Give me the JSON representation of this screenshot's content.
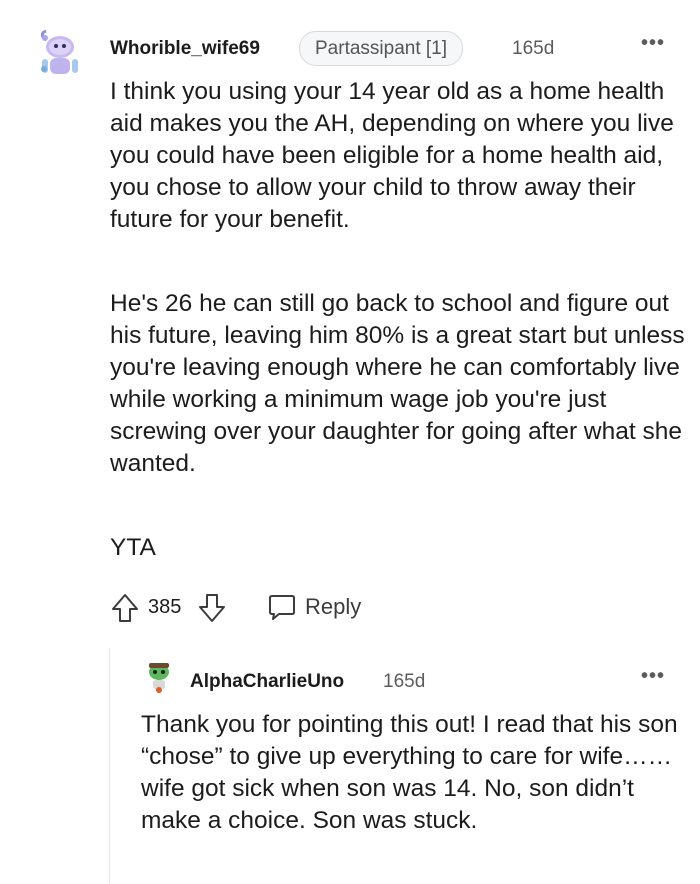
{
  "comment": {
    "author": "Whorible_wife69",
    "flair": "Partassipant [1]",
    "time": "165d",
    "more_label": "•••",
    "paragraphs": [
      "I think you using your 14 year old as a home health aid makes you the AH, depending on where you live you could have been eligible for a home health aid, you chose to allow your child to throw away their future for your benefit.",
      "He's 26 he can still go back to school and figure out his future, leaving him 80% is a great start but unless you're leaving enough where he can comfortably live while working a minimum wage job you're just screwing over your daughter for going after what she wanted.",
      "YTA"
    ],
    "votes": "385",
    "reply_label": "Reply"
  },
  "reply": {
    "author": "AlphaCharlieUno",
    "time": "165d",
    "more_label": "•••",
    "text": "Thank you for pointing this out! I read that his son “chose” to give up everything to care for wife…… wife got sick when son was 14. No, son didn’t make a choice. Son was stuck."
  },
  "icons": {
    "upvote": "upvote-arrow-icon",
    "downvote": "downvote-arrow-icon",
    "reply": "speech-bubble-icon",
    "avatar1": "snoo-avatar-lavender",
    "avatar2": "snoo-avatar-green"
  },
  "colors": {
    "text": "#1c1c1c",
    "meta": "#5c5c5c",
    "flair_bg": "#f6f7f8",
    "thread_line": "#e4e4e4"
  }
}
